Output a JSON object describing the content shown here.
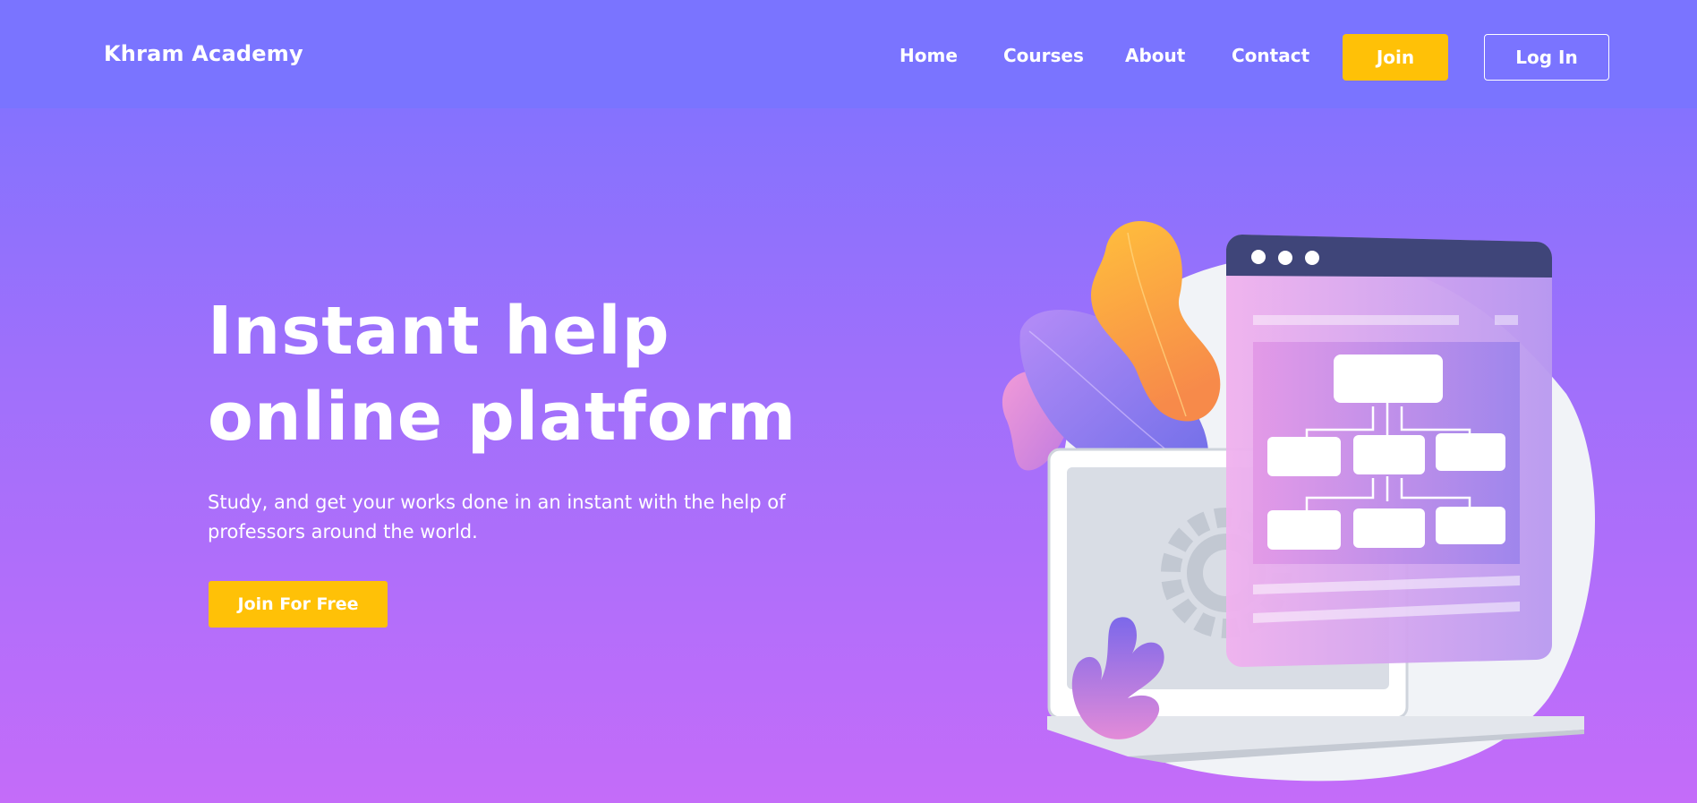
{
  "header": {
    "logo": "Khram Academy",
    "nav": [
      "Home",
      "Courses",
      "About",
      "Contact"
    ],
    "join_label": "Join",
    "login_label": "Log In"
  },
  "hero": {
    "title_line1": "Instant help",
    "title_line2": "online platform",
    "subtitle": "Study, and get your works done in an instant with the help of professors around the world.",
    "cta_label": "Join For Free"
  },
  "colors": {
    "header_bg": "#7a74ff",
    "gradient_top": "#7a73ff",
    "gradient_bottom": "#c46cf9",
    "accent": "#ffc107",
    "text": "#ffffff"
  },
  "illustration": {
    "icons": [
      "laptop-icon",
      "browser-window-icon",
      "flowchart-icon",
      "gear-icon",
      "leaf-icon"
    ]
  }
}
